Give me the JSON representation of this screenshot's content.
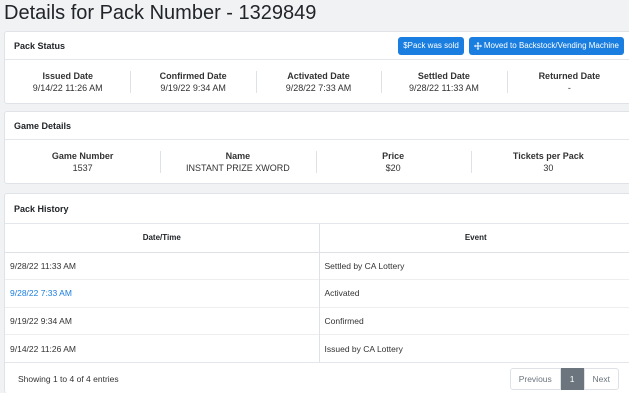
{
  "page": {
    "title": "Details for Pack Number - 1329849"
  },
  "pack_status": {
    "header": "Pack Status",
    "sold_button": "$Pack was sold",
    "move_button": "Moved to Backstock/Vending Machine",
    "stats": [
      {
        "label": "Issued Date",
        "value": "9/14/22 11:26 AM"
      },
      {
        "label": "Confirmed Date",
        "value": "9/19/22 9:34 AM"
      },
      {
        "label": "Activated Date",
        "value": "9/28/22 7:33 AM"
      },
      {
        "label": "Settled Date",
        "value": "9/28/22 11:33 AM"
      },
      {
        "label": "Returned Date",
        "value": "-"
      }
    ]
  },
  "game_details": {
    "header": "Game Details",
    "stats": [
      {
        "label": "Game Number",
        "value": "1537"
      },
      {
        "label": "Name",
        "value": "INSTANT PRIZE XWORD"
      },
      {
        "label": "Price",
        "value": "$20"
      },
      {
        "label": "Tickets per Pack",
        "value": "30"
      }
    ]
  },
  "pack_history": {
    "header": "Pack History",
    "columns": [
      "Date/Time",
      "Event"
    ],
    "rows": [
      {
        "datetime": "9/28/22 11:33 AM",
        "event": "Settled by CA Lottery"
      },
      {
        "datetime": "9/28/22 7:33 AM",
        "event": "Activated"
      },
      {
        "datetime": "9/19/22 9:34 AM",
        "event": "Confirmed"
      },
      {
        "datetime": "9/14/22 11:26 AM",
        "event": "Issued by CA Lottery"
      }
    ],
    "info": "Showing 1 to 4 of 4 entries",
    "pagination": {
      "previous": "Previous",
      "current": "1",
      "next": "Next"
    }
  },
  "colors": {
    "primary": "#1a7ee0",
    "link": "#1a7ee0",
    "page_bg": "#f1f2f4"
  },
  "icons": {
    "move_button_icon": "arrows-move-icon"
  }
}
